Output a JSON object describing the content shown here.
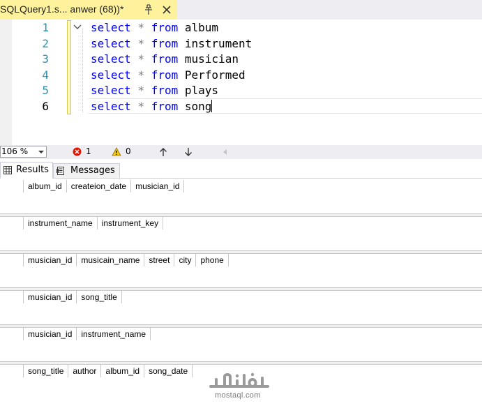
{
  "tab": {
    "title": "SQLQuery1.s... anwer (68))*"
  },
  "editor": {
    "lines": [
      {
        "number": "1",
        "keyword1": "select",
        "star": "*",
        "keyword2": "from",
        "table": "album"
      },
      {
        "number": "2",
        "keyword1": "select",
        "star": "*",
        "keyword2": "from",
        "table": "instrument"
      },
      {
        "number": "3",
        "keyword1": "select",
        "star": "*",
        "keyword2": "from",
        "table": "musician"
      },
      {
        "number": "4",
        "keyword1": "select",
        "star": "*",
        "keyword2": "from",
        "table": "Performed"
      },
      {
        "number": "5",
        "keyword1": "select",
        "star": "*",
        "keyword2": "from",
        "table": "plays"
      },
      {
        "number": "6",
        "keyword1": "select",
        "star": "*",
        "keyword2": "from",
        "table": "song"
      }
    ],
    "colors": {
      "keyword": "#0000ff",
      "line_number": "#2b91af",
      "operator": "#808080"
    }
  },
  "status": {
    "zoom": "106 %",
    "errors": "1",
    "warnings": "0"
  },
  "results_tabs": [
    {
      "label": "Results",
      "icon": "grid-icon"
    },
    {
      "label": "Messages",
      "icon": "messages-icon"
    }
  ],
  "grids": [
    {
      "columns": [
        "album_id",
        "createion_date",
        "musician_id"
      ]
    },
    {
      "columns": [
        "instrument_name",
        "instrument_key"
      ]
    },
    {
      "columns": [
        "musician_id",
        "musicain_name",
        "street",
        "city",
        "phone"
      ]
    },
    {
      "columns": [
        "musician_id",
        "song_title"
      ]
    },
    {
      "columns": [
        "musician_id",
        "instrument_name"
      ]
    },
    {
      "columns": [
        "song_title",
        "author",
        "album_id",
        "song_date"
      ]
    }
  ],
  "watermark": {
    "text": "mostaql.com"
  }
}
